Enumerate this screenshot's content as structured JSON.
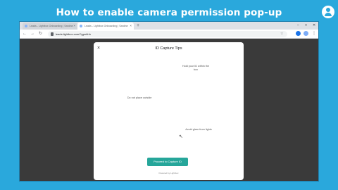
{
  "video": {
    "title": "How to enable camera permission pop-up",
    "logo_icon": "person-pin-icon"
  },
  "browser": {
    "tabs": [
      {
        "label": "Leads - Lightbox Onboarding | Sardine"
      },
      {
        "label": "Leads - Lightbox Onboarding | Sardine"
      }
    ],
    "new_tab_label": "+",
    "url": "leads.lightbox.com/?gpnhhh",
    "window_controls": {
      "minimize": "–",
      "maximize": "□",
      "close": "✕"
    },
    "nav": {
      "back": "←",
      "forward": "→",
      "reload": "↻"
    },
    "menu_label": "⋮",
    "bookmark_label": "☆",
    "colors": {
      "accent": "#1a73e8"
    }
  },
  "modal": {
    "close_label": "×",
    "title": "ID Capture Tips",
    "tips": [
      "Hold your ID within the box",
      "Do not place outside",
      "Avoid glare from lights"
    ],
    "proceed_label": "Proceed to Capture ID",
    "powered_by": "Powered by Lightbox",
    "button_color": "#26a69a"
  }
}
